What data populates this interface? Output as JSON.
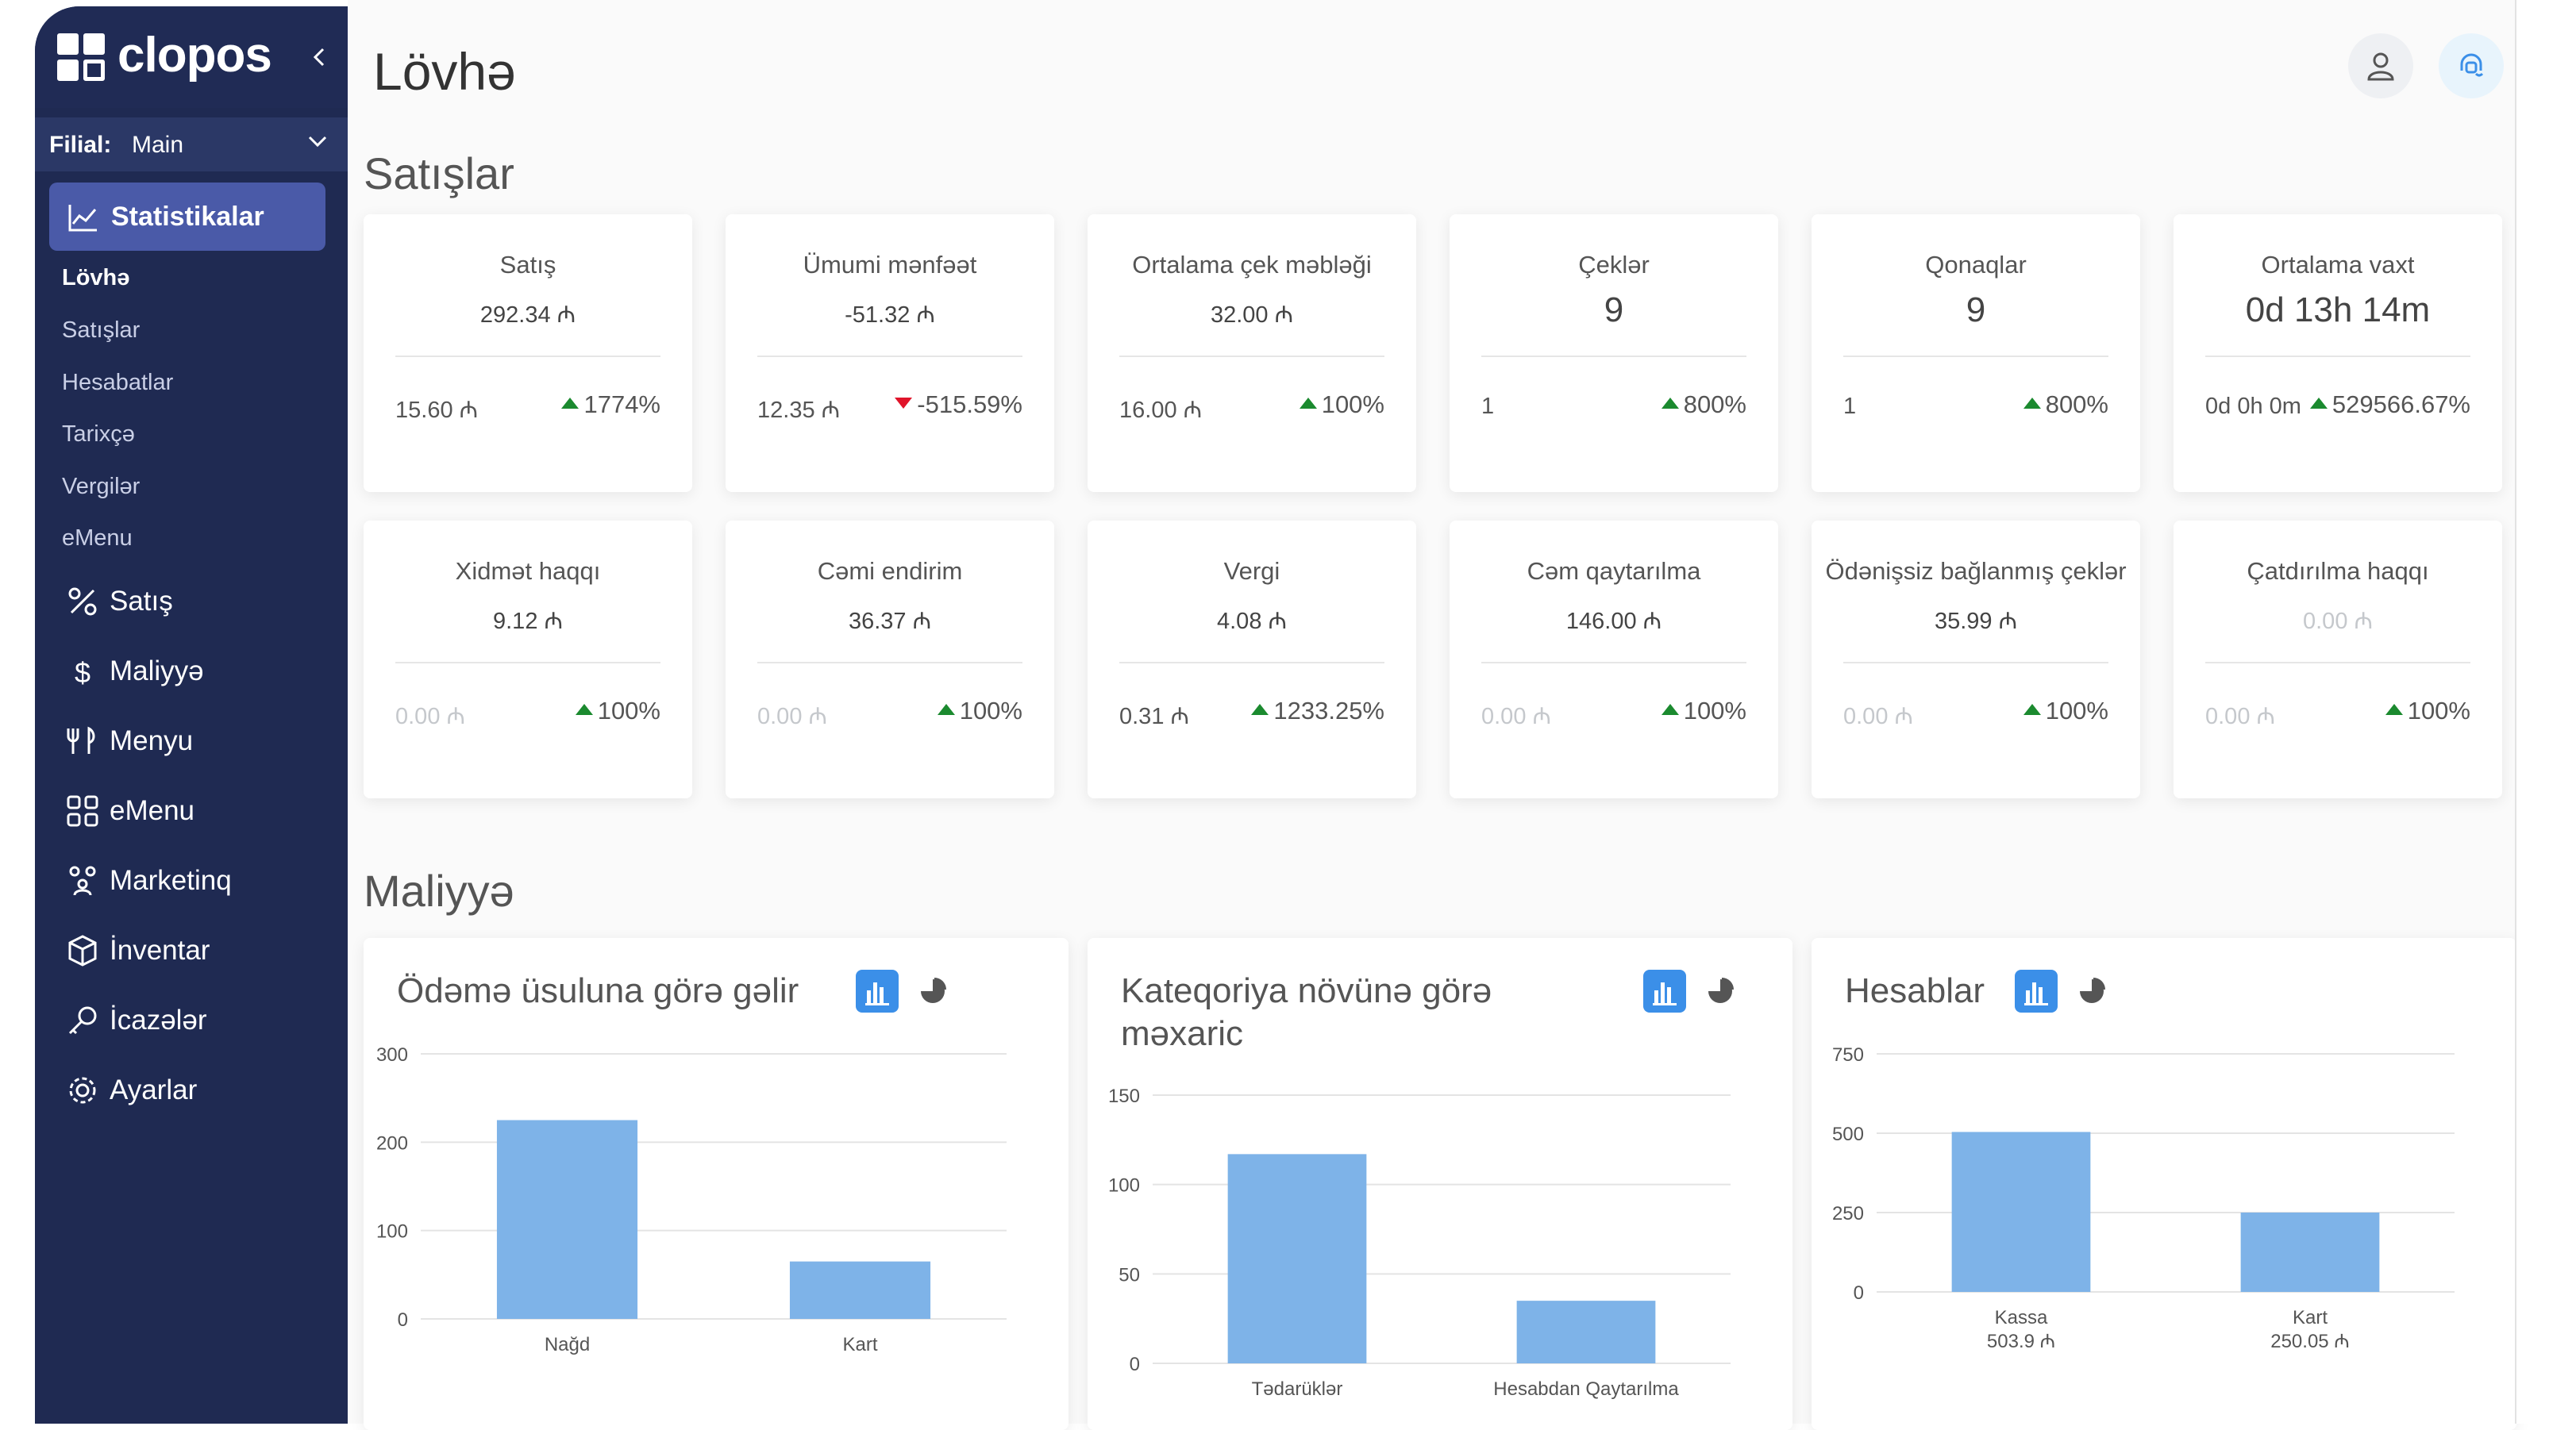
{
  "app": {
    "name": "clopos",
    "collapse_icon": "chevron-left-icon"
  },
  "branch": {
    "label": "Filial:",
    "value": "Main"
  },
  "nav": {
    "active": {
      "label": "Statistikalar",
      "icon": "chart-line-icon"
    },
    "subitems": [
      "Lövhə",
      "Satışlar",
      "Hesabatlar",
      "Tarixçə",
      "Vergilər",
      "eMenu"
    ],
    "items": [
      {
        "label": "Satış",
        "icon": "percent-icon"
      },
      {
        "label": "Maliyyə",
        "icon": "dollar-icon"
      },
      {
        "label": "Menyu",
        "icon": "cutlery-icon"
      },
      {
        "label": "eMenu",
        "icon": "qr-code-icon"
      },
      {
        "label": "Marketinq",
        "icon": "users-icon"
      },
      {
        "label": "İnventar",
        "icon": "box-icon"
      },
      {
        "label": "İcazələr",
        "icon": "key-icon"
      },
      {
        "label": "Ayarlar",
        "icon": "gear-icon"
      }
    ]
  },
  "page": {
    "title": "Lövhə"
  },
  "sections": {
    "sales": "Satışlar",
    "finance": "Maliyyə"
  },
  "colors": {
    "sidebar": "#1f2a52",
    "accent": "#4a5aa8",
    "bar": "#7eb3e8",
    "up": "#1b8a2f",
    "down": "#e0142a"
  },
  "stat_cards": [
    {
      "title": "Satış",
      "value": "292.34 ₼",
      "prev": "15.60 ₼",
      "change": "1774%",
      "dir": "up"
    },
    {
      "title": "Ümumi mənfəət",
      "value": "-51.32 ₼",
      "prev": "12.35 ₼",
      "change": "-515.59%",
      "dir": "down"
    },
    {
      "title": "Ortalama çek məbləği",
      "value": "32.00 ₼",
      "prev": "16.00 ₼",
      "change": "100%",
      "dir": "up"
    },
    {
      "title": "Çeklər",
      "value": "9",
      "prev": "1",
      "change": "800%",
      "dir": "up",
      "big": true
    },
    {
      "title": "Qonaqlar",
      "value": "9",
      "prev": "1",
      "change": "800%",
      "dir": "up",
      "big": true
    },
    {
      "title": "Ortalama vaxt",
      "value": "0d 13h 14m",
      "prev": "0d 0h 0m",
      "change": "529566.67%",
      "dir": "up",
      "big": true
    },
    {
      "title": "Xidmət haqqı",
      "value": "9.12 ₼",
      "prev": "0.00 ₼",
      "change": "100%",
      "dir": "up",
      "muted_prev": true
    },
    {
      "title": "Cəmi endirim",
      "value": "36.37 ₼",
      "prev": "0.00 ₼",
      "change": "100%",
      "dir": "up",
      "muted_prev": true
    },
    {
      "title": "Vergi",
      "value": "4.08 ₼",
      "prev": "0.31 ₼",
      "change": "1233.25%",
      "dir": "up"
    },
    {
      "title": "Cəm qaytarılma",
      "value": "146.00 ₼",
      "prev": "0.00 ₼",
      "change": "100%",
      "dir": "up",
      "muted_prev": true
    },
    {
      "title": "Ödənişsiz bağlanmış çeklər",
      "value": "35.99 ₼",
      "prev": "0.00 ₼",
      "change": "100%",
      "dir": "up",
      "muted_prev": true
    },
    {
      "title": "Çatdırılma haqqı",
      "value": "0.00 ₼",
      "prev": "0.00 ₼",
      "change": "100%",
      "dir": "up",
      "muted_prev": true,
      "muted_value": true
    }
  ],
  "chart_data": [
    {
      "type": "bar",
      "title": "Ödəmə üsuluna görə gəlir",
      "categories": [
        "Nağd",
        "Kart"
      ],
      "values": [
        225,
        65
      ],
      "ylim": [
        0,
        300
      ],
      "yticks": [
        0,
        100,
        200,
        300
      ],
      "grid": true
    },
    {
      "type": "bar",
      "title": "Kateqoriya növünə görə məxaric",
      "categories": [
        "Tədarüklər",
        "Hesabdan Qaytarılma"
      ],
      "values": [
        117,
        35
      ],
      "ylim": [
        0,
        150
      ],
      "yticks": [
        0,
        50,
        100,
        150
      ],
      "grid": true
    },
    {
      "type": "bar",
      "title": "Hesablar",
      "categories": [
        "Kassa",
        "Kart"
      ],
      "category_sublabels": [
        "503.9 ₼",
        "250.05 ₼"
      ],
      "values": [
        503.9,
        250.05
      ],
      "ylim": [
        0,
        750
      ],
      "yticks": [
        0,
        250,
        500,
        750
      ],
      "grid": true
    }
  ]
}
